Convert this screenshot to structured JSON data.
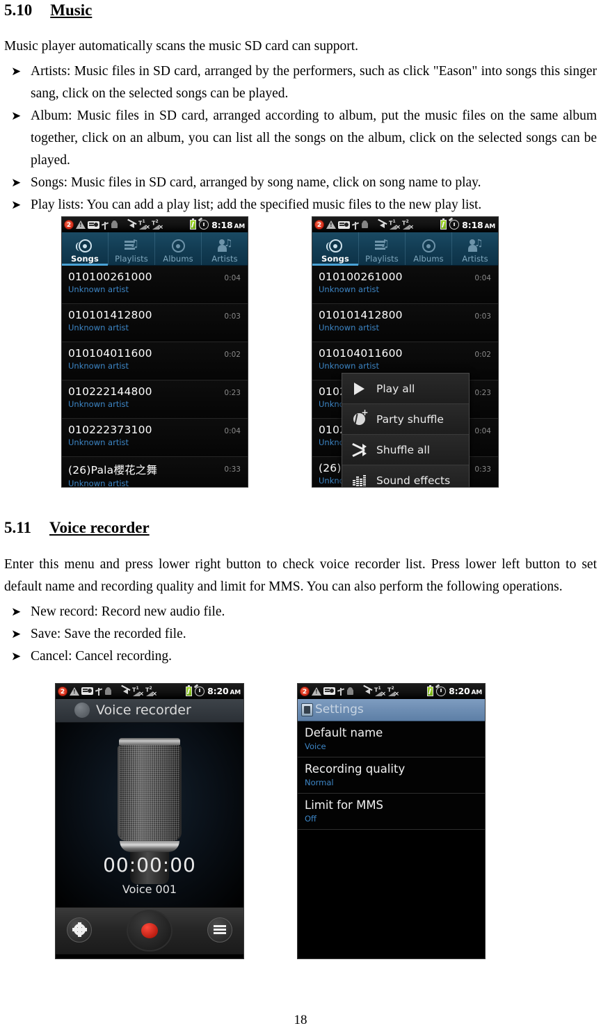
{
  "document": {
    "page_number": "18",
    "sections": [
      {
        "number": "5.10",
        "title": "Music",
        "intro": "Music player automatically scans the music SD card can support.",
        "bullets": [
          "Artists: Music files in SD card, arranged by the performers, such as click \"Eason\" into songs this singer sang, click on the selected songs can be played.",
          "Album: Music files in SD card, arranged according to album, put the music files on the same album together, click on an album, you can list all the songs on the album, click on the selected songs can be played.",
          "Songs: Music files in SD card, arranged by song name, click on song name to play.",
          "Play lists: You can add a play list; add the specified music files to the new play list."
        ]
      },
      {
        "number": "5.11",
        "title": "Voice recorder",
        "intro": "Enter this menu and press lower right button to check voice recorder list. Press lower left button to set default name and recording quality and limit for MMS. You can also perform the following operations.",
        "bullets": [
          "New record: Record new audio file.",
          "Save: Save the recorded file.",
          "Cancel: Cancel recording."
        ]
      }
    ]
  },
  "music_screenshot_left": {
    "statusbar": {
      "notification_count": "2",
      "time": "8:18",
      "ampm": "AM",
      "icons": [
        "notification-badge-icon",
        "warning-icon",
        "fm-radio-icon",
        "usb-icon",
        "android-debug-icon",
        "silent-mute-icon",
        "sim1-no-signal-icon",
        "sim2-no-signal-icon",
        "battery-charging-icon",
        "alarm-clock-icon"
      ]
    },
    "tabs": [
      {
        "label": "Songs",
        "icon": "disc-icon",
        "active": true
      },
      {
        "label": "Playlists",
        "icon": "playlist-note-icon",
        "active": false
      },
      {
        "label": "Albums",
        "icon": "album-disc-icon",
        "active": false
      },
      {
        "label": "Artists",
        "icon": "artist-note-icon",
        "active": false
      }
    ],
    "songs": [
      {
        "title": "010100261000",
        "artist": "Unknown artist",
        "duration": "0:04"
      },
      {
        "title": "010101412800",
        "artist": "Unknown artist",
        "duration": "0:03"
      },
      {
        "title": "010104011600",
        "artist": "Unknown artist",
        "duration": "0:02"
      },
      {
        "title": "010222144800",
        "artist": "Unknown artist",
        "duration": "0:23"
      },
      {
        "title": "010222373100",
        "artist": "Unknown artist",
        "duration": "0:04"
      },
      {
        "title": "(26)Pala櫻花之舞",
        "artist": "Unknown artist",
        "duration": "0:33"
      }
    ]
  },
  "music_screenshot_right": {
    "statusbar": {
      "notification_count": "2",
      "time": "8:18",
      "ampm": "AM"
    },
    "tabs": [
      {
        "label": "Songs",
        "icon": "disc-icon",
        "active": true
      },
      {
        "label": "Playlists",
        "icon": "playlist-note-icon",
        "active": false
      },
      {
        "label": "Albums",
        "icon": "album-disc-icon",
        "active": false
      },
      {
        "label": "Artists",
        "icon": "artist-note-icon",
        "active": false
      }
    ],
    "songs": [
      {
        "title": "010100261000",
        "artist": "Unknown artist",
        "duration": "0:04"
      },
      {
        "title": "010101412800",
        "artist": "Unknown artist",
        "duration": "0:03"
      },
      {
        "title": "010104011600",
        "artist": "Unknown artist",
        "duration": "0:02"
      },
      {
        "title": "0102",
        "artist": "Unkno",
        "duration": "0:23"
      },
      {
        "title": "0102",
        "artist": "Unkno",
        "duration": "0:04"
      },
      {
        "title": "(26)P",
        "artist": "Unkno",
        "duration": "0:33"
      }
    ],
    "context_menu": [
      {
        "label": "Play all",
        "icon": "play-icon"
      },
      {
        "label": "Party shuffle",
        "icon": "party-shuffle-icon"
      },
      {
        "label": "Shuffle all",
        "icon": "shuffle-icon"
      },
      {
        "label": "Sound effects",
        "icon": "equalizer-icon"
      }
    ]
  },
  "voice_recorder_screenshot": {
    "statusbar": {
      "notification_count": "2",
      "time": "8:20",
      "ampm": "AM"
    },
    "title": "Voice recorder",
    "timer": "00:00:00",
    "file_name": "Voice 001",
    "toolbar": {
      "settings_icon": "gear-icon",
      "record_button": "record-button",
      "list_icon": "menu-list-icon"
    }
  },
  "settings_screenshot": {
    "statusbar": {
      "notification_count": "2",
      "time": "8:20",
      "ampm": "AM"
    },
    "title": "Settings",
    "rows": [
      {
        "label": "Default name",
        "value": "Voice"
      },
      {
        "label": "Recording quality",
        "value": "Normal"
      },
      {
        "label": "Limit for MMS",
        "value": "Off"
      }
    ]
  }
}
